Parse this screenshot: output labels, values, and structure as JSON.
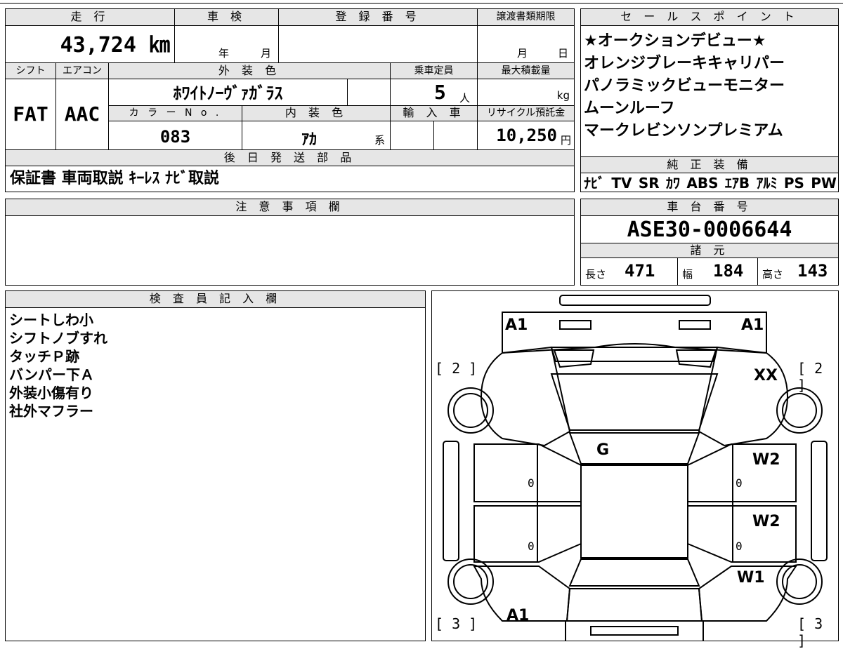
{
  "main": {
    "mileage_label": "走 行",
    "mileage_value": "43,724 ㎞",
    "shaken_label": "車 検",
    "shaken_year": "年",
    "shaken_month": "月",
    "reg_label": "登 録 番 号",
    "transfer_label": "譲渡書類期限",
    "transfer_month": "月",
    "transfer_day": "日",
    "shift_label": "シフト",
    "shift_value": "FAT",
    "ac_label": "エアコン",
    "ac_value": "AAC",
    "ext_color_label": "外 装 色",
    "ext_color_value": "ﾎﾜｲﾄﾉｰｳﾞｧｶﾞﾗｽ",
    "capacity_label": "乗車定員",
    "capacity_value": "5",
    "capacity_unit": "人",
    "maxload_label": "最大積載量",
    "maxload_unit": "kg",
    "color_no_label": "カ ラ ー N o .",
    "color_no_value": "083",
    "int_color_label": "内 装 色",
    "int_color_value": "ｱｶ",
    "int_color_suffix": "系",
    "import_label": "輸 入 車",
    "recycle_label": "リサイクル預託金",
    "recycle_value": "10,250",
    "recycle_unit": "円",
    "later_label": "後 日 発 送 部 品",
    "later_value": "保証書 車両取説 ｷｰﾚｽ ﾅﾋﾞ取説"
  },
  "sales": {
    "label": "セ ー ル ス ポ イ ン ト",
    "lines": [
      "★オークションデビュー★",
      "オレンジブレーキキャリパー",
      "パノラミックビューモニター",
      "ムーンルーフ",
      "マークレビンソンプレミアム"
    ]
  },
  "equipment": {
    "label": "純 正 装 備",
    "items": [
      "ﾅﾋﾞ",
      "TV",
      "SR",
      "ｶﾜ",
      "ABS",
      "ｴｱB",
      "ｱﾙﾐ",
      "PS",
      "PW"
    ]
  },
  "notes": {
    "label": "注 意 事 項 欄",
    "text": ""
  },
  "chassis": {
    "label": "車 台 番 号",
    "value": "ASE30-0006644",
    "spec_label": "諸 元",
    "length_label": "長さ",
    "length_value": "471",
    "width_label": "幅",
    "width_value": "184",
    "height_label": "高さ",
    "height_value": "143"
  },
  "inspector": {
    "label": "検 査 員 記 入 欄",
    "lines": [
      "シートしわ小",
      "シフトノブすれ",
      "タッチＰ跡",
      "バンパー下Ａ",
      "外装小傷有り",
      "社外マフラー"
    ]
  },
  "diagram": {
    "marks": {
      "front_left": "A1",
      "front_right": "A1",
      "fender_right": "XX",
      "roof": "G",
      "door_right_front": "W2",
      "door_right_rear": "W2",
      "quarter_right": "W1",
      "rear_left": "A1"
    },
    "corner_numbers": {
      "top_left": "[ 2 ]",
      "top_right": "[ 2 ]",
      "bottom_left": "[ 3 ]",
      "bottom_right": "[ 3 ]"
    },
    "zeros": [
      "0",
      "0",
      "0",
      "0"
    ]
  }
}
